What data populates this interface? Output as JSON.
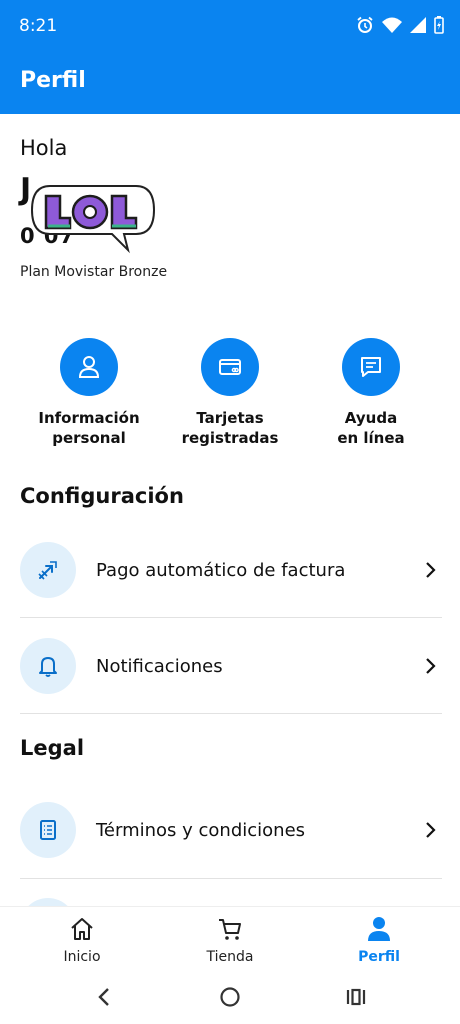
{
  "status_bar": {
    "time": "8:21",
    "icons": [
      "alarm-icon",
      "wifi-icon",
      "signal-icon",
      "battery-icon"
    ]
  },
  "app_bar": {
    "title": "Perfil"
  },
  "profile": {
    "greeting": "Hola",
    "name": "J",
    "phone": "0      07",
    "plan": "Plan Movistar Bronze",
    "sticker_text": "LOL"
  },
  "quick_actions": [
    {
      "label": "Información\npersonal",
      "icon": "person-icon"
    },
    {
      "label": "Tarjetas\nregistradas",
      "icon": "credit-card-icon"
    },
    {
      "label": "Ayuda\nen línea",
      "icon": "chat-icon"
    }
  ],
  "sections": {
    "config_title": "Configuración",
    "config_items": [
      {
        "label": "Pago automático de factura",
        "icon": "auto-pay-icon"
      },
      {
        "label": "Notificaciones",
        "icon": "bell-icon"
      }
    ],
    "legal_title": "Legal",
    "legal_items": [
      {
        "label": "Términos y condiciones",
        "icon": "document-list-icon"
      }
    ]
  },
  "bottom_nav": {
    "items": [
      {
        "label": "Inicio",
        "icon": "home-icon"
      },
      {
        "label": "Tienda",
        "icon": "cart-icon"
      },
      {
        "label": "Perfil",
        "icon": "profile-icon",
        "active": true
      }
    ]
  },
  "colors": {
    "primary": "#0a84f0",
    "icon_bg": "#e1f0fb",
    "text": "#111111"
  }
}
